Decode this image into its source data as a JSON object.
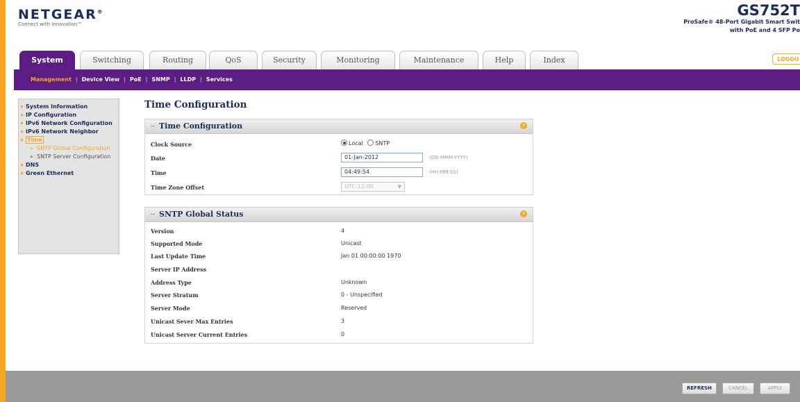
{
  "brand": {
    "logo": "NETGEAR",
    "tagline": "Connect with Innovation™"
  },
  "product": {
    "model": "GS752T",
    "line1": "ProSafe® 48-Port Gigabit Smart Swit",
    "line2": "with PoE and 4 SFP Po"
  },
  "tabs": [
    {
      "label": "System"
    },
    {
      "label": "Switching"
    },
    {
      "label": "Routing"
    },
    {
      "label": "QoS"
    },
    {
      "label": "Security"
    },
    {
      "label": "Monitoring"
    },
    {
      "label": "Maintenance"
    },
    {
      "label": "Help"
    },
    {
      "label": "Index"
    }
  ],
  "logout_label": "LOGOU",
  "subnav": [
    {
      "label": "Management"
    },
    {
      "label": "Device View"
    },
    {
      "label": "PoE"
    },
    {
      "label": "SNMP"
    },
    {
      "label": "LLDP"
    },
    {
      "label": "Services"
    }
  ],
  "sidebar": {
    "system_information": "System Information",
    "ip_configuration": "IP Configuration",
    "ipv6_network_configuration": "IPv6 Network Configuration",
    "ipv6_network_neighbor": "IPv6 Network Neighbor",
    "time": "Time",
    "sntp_global_configuration": "SNTP Global Configuration",
    "sntp_server_configuration": "SNTP Server Configuration",
    "dns": "DNS",
    "green_ethernet": "Green Ethernet"
  },
  "page_title": "Time Configuration",
  "time_config": {
    "heading": "Time Configuration",
    "clock_source_label": "Clock Source",
    "clock_local": "Local",
    "clock_sntp": "SNTP",
    "date_label": "Date",
    "date_value": "01-Jan-2012",
    "date_hint": "(DD-MMM-YYYY)",
    "time_label": "Time",
    "time_value": "04:49:54",
    "time_hint": "(HH:MM:SS)",
    "tz_label": "Time Zone Offset",
    "tz_value": "UTC-12:00"
  },
  "sntp_status": {
    "heading": "SNTP Global Status",
    "rows": [
      {
        "label": "Version",
        "value": "4"
      },
      {
        "label": "Supported Mode",
        "value": "Unicast"
      },
      {
        "label": "Last Update Time",
        "value": "Jan 01 00:00:00 1970"
      },
      {
        "label": "Server IP Address",
        "value": ""
      },
      {
        "label": "Address Type",
        "value": "Unknown"
      },
      {
        "label": "Server Stratum",
        "value": "0 - Unspecified"
      },
      {
        "label": "Server Mode",
        "value": "Reserved"
      },
      {
        "label": "Unicast Sever Max Entries",
        "value": "3"
      },
      {
        "label": "Unicast Server Current Entries",
        "value": "0"
      }
    ]
  },
  "buttons": {
    "refresh": "REFRESH",
    "cancel": "CANCEL",
    "apply": "APPLY"
  },
  "colors": {
    "brand_purple": "#5b1d84",
    "accent_orange": "#f5a623",
    "navy": "#1a2d57"
  }
}
